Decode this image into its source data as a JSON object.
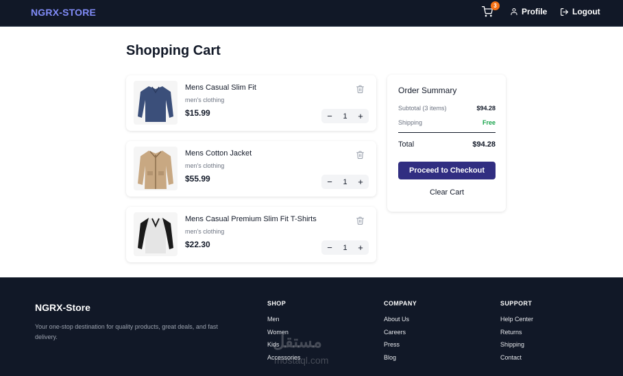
{
  "header": {
    "brand": "NGRX-STORE",
    "cart_count": "3",
    "profile_label": "Profile",
    "logout_label": "Logout"
  },
  "main": {
    "title": "Shopping Cart",
    "items": [
      {
        "name": "Mens Casual Slim Fit",
        "category": "men's clothing",
        "price": "$15.99",
        "qty": "1"
      },
      {
        "name": "Mens Cotton Jacket",
        "category": "men's clothing",
        "price": "$55.99",
        "qty": "1"
      },
      {
        "name": "Mens Casual Premium Slim Fit T-Shirts",
        "category": "men's clothing",
        "price": "$22.30",
        "qty": "1"
      }
    ],
    "stepper": {
      "minus": "−",
      "plus": "+"
    }
  },
  "summary": {
    "title": "Order Summary",
    "subtotal_label": "Subtotal (3 items)",
    "subtotal_value": "$94.28",
    "shipping_label": "Shipping",
    "shipping_value": "Free",
    "total_label": "Total",
    "total_value": "$94.28",
    "checkout_label": "Proceed to Checkout",
    "clear_label": "Clear Cart"
  },
  "footer": {
    "brand": "NGRX-Store",
    "description": "Your one-stop destination for quality products, great deals, and fast delivery.",
    "shop": {
      "heading": "SHOP",
      "links": [
        "Men",
        "Women",
        "Kids",
        "Accessories"
      ]
    },
    "company": {
      "heading": "COMPANY",
      "links": [
        "About Us",
        "Careers",
        "Press",
        "Blog"
      ]
    },
    "support": {
      "heading": "SUPPORT",
      "links": [
        "Help Center",
        "Returns",
        "Shipping",
        "Contact"
      ]
    }
  },
  "watermark": {
    "text": "مستقل",
    "sub": "mostaql.com"
  },
  "colors": {
    "header_bg": "#111827",
    "brand": "#818cf8",
    "badge": "#f97316",
    "checkout_bg": "#312e81",
    "free": "#16a34a"
  },
  "icons": [
    "cart-icon",
    "user-icon",
    "logout-icon",
    "trash-icon"
  ]
}
